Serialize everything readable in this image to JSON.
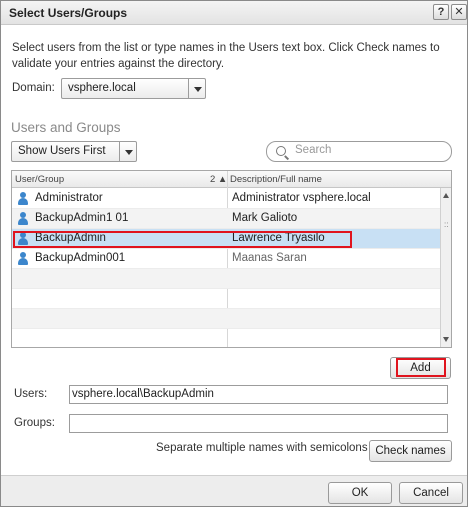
{
  "window": {
    "title": "Select Users/Groups",
    "help_glyph": "?",
    "close_glyph": "✕"
  },
  "instructions": "Select users from the list or type names in the Users text box. Click Check names to validate your entries against the directory.",
  "domain": {
    "label": "Domain:",
    "value": "vsphere.local"
  },
  "users_and_groups": {
    "section_title": "Users and Groups",
    "filter_value": "Show Users First",
    "search_placeholder": "Search",
    "columns": {
      "user_group": "User/Group",
      "sort_indicator": "2 ▲",
      "description": "Description/Full name"
    },
    "rows": [
      {
        "name": "Administrator",
        "description": "Administrator vsphere.local",
        "selected": false
      },
      {
        "name": "BackupAdmin1 01",
        "description": "Mark Galioto",
        "selected": false
      },
      {
        "name": "BackupAdmin",
        "description": "Lawrence Tryasilo",
        "selected": true
      },
      {
        "name": "BackupAdmin001",
        "description": "Maanas Saran",
        "selected": false
      }
    ],
    "scroll_grip": "::"
  },
  "add_label": "Add",
  "users_field": {
    "label": "Users:",
    "value": "vsphere.local\\BackupAdmin"
  },
  "groups_field": {
    "label": "Groups:",
    "value": ""
  },
  "hint": "Separate multiple names with semicolons",
  "check_names_label": "Check names",
  "ok_label": "OK",
  "cancel_label": "Cancel",
  "colors": {
    "selection": "#c8e0f4",
    "highlight": "#e0141e",
    "user_icon": "#3c86cc"
  }
}
